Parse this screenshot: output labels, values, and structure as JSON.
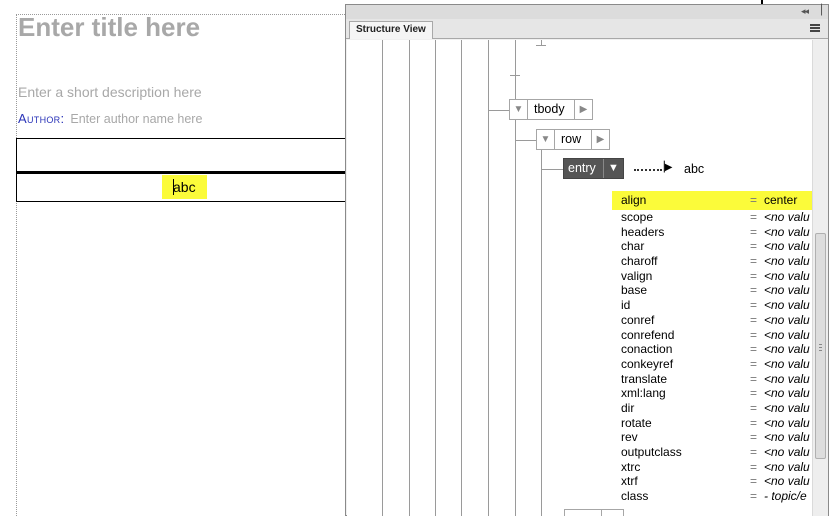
{
  "editor": {
    "title_placeholder": "Enter title here",
    "description_placeholder": "Enter a short description here",
    "author_label": "Author:",
    "author_placeholder": "Enter author name here",
    "cell_text": "abc"
  },
  "panel": {
    "tab_label": "Structure View",
    "nodes": {
      "tbody": "tbody",
      "row": "row",
      "entry": "entry"
    },
    "entry_text": "abc",
    "attributes": [
      {
        "name": "align",
        "value": "center"
      },
      {
        "name": "scope",
        "value": "<no valu"
      },
      {
        "name": "headers",
        "value": "<no valu"
      },
      {
        "name": "char",
        "value": "<no valu"
      },
      {
        "name": "charoff",
        "value": "<no valu"
      },
      {
        "name": "valign",
        "value": "<no valu"
      },
      {
        "name": "base",
        "value": "<no valu"
      },
      {
        "name": "id",
        "value": "<no valu"
      },
      {
        "name": "conref",
        "value": "<no valu"
      },
      {
        "name": "conrefend",
        "value": "<no valu"
      },
      {
        "name": "conaction",
        "value": "<no valu"
      },
      {
        "name": "conkeyref",
        "value": "<no valu"
      },
      {
        "name": "translate",
        "value": "<no valu"
      },
      {
        "name": "xml:lang",
        "value": "<no valu"
      },
      {
        "name": "dir",
        "value": "<no valu"
      },
      {
        "name": "rotate",
        "value": "<no valu"
      },
      {
        "name": "rev",
        "value": "<no valu"
      },
      {
        "name": "outputclass",
        "value": "<no valu"
      },
      {
        "name": "xtrc",
        "value": "<no valu"
      },
      {
        "name": "xtrf",
        "value": "<no valu"
      },
      {
        "name": "class",
        "value": "- topic/e"
      }
    ],
    "eq": "="
  },
  "colors": {
    "highlight": "#fbfb3a",
    "selected_node": "#555555",
    "author_label": "#2a34b8",
    "placeholder": "#a8a8a8"
  },
  "icons": [
    "collapse-panel-icon",
    "panel-menu-icon",
    "expand-triangle-icon",
    "next-arrow-icon",
    "link-arrow-icon"
  ]
}
